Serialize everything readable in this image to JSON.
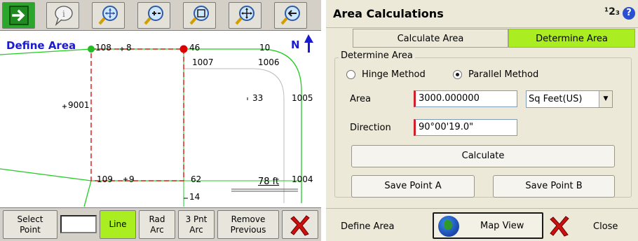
{
  "left": {
    "toolbar": {
      "icons": [
        "exit-arrow-icon",
        "info-icon",
        "zoom-extents-icon",
        "zoom-in-icon",
        "zoom-window-icon",
        "pan-icon",
        "zoom-previous-icon"
      ]
    },
    "map": {
      "title": "Define Area",
      "north_label": "N",
      "scale_label": "78 ft",
      "points": [
        "108",
        "8",
        "46",
        "10",
        "1007",
        "1006",
        "9001",
        "33",
        "1005",
        "1004",
        "109",
        "9",
        "62",
        "14"
      ],
      "colors": {
        "line_green": "#22cc22",
        "line_red": "#dd2222",
        "point_red": "#dd0000",
        "point_green": "#22bb22",
        "text_blue": "#1a1ad0"
      }
    },
    "bottom": {
      "select_point": [
        "Select",
        "Point"
      ],
      "line": "Line",
      "rad_arc": [
        "Rad",
        "Arc"
      ],
      "three_pnt_arc": [
        "3 Pnt",
        "Arc"
      ],
      "remove_previous": [
        "Remove",
        "Previous"
      ],
      "close_icon": "close-x-icon"
    }
  },
  "right": {
    "title": "Area Calculations",
    "badge": "¹2₃",
    "tabs": {
      "calculate": "Calculate Area",
      "determine": "Determine Area"
    },
    "group_title": "Determine Area",
    "radios": {
      "hinge": "Hinge Method",
      "parallel": "Parallel Method"
    },
    "selected_method": "Parallel Method",
    "area_label": "Area",
    "area_value": "3000.000000",
    "unit_value": "Sq Feet(US)",
    "direction_label": "Direction",
    "direction_value": "90°00'19.0\"",
    "calculate_button": "Calculate",
    "save_a_button": "Save Point A",
    "save_b_button": "Save Point B",
    "bottom": {
      "define_area": "Define Area",
      "map_view": "Map View",
      "close": "Close"
    }
  }
}
